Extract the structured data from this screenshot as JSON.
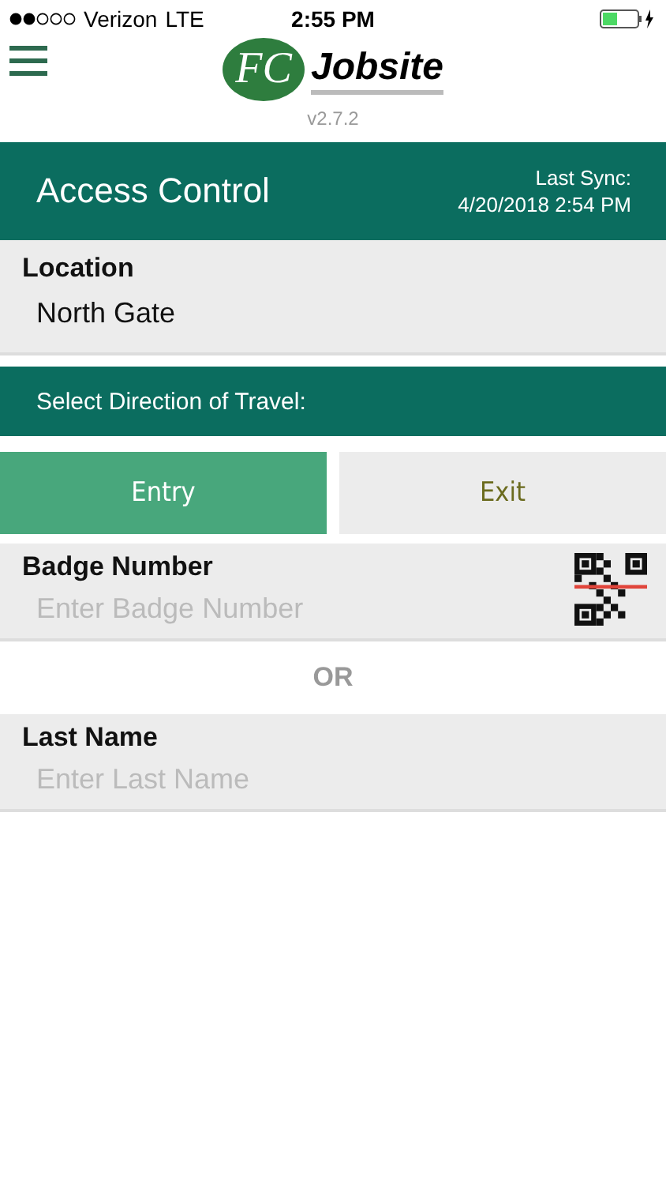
{
  "status_bar": {
    "carrier": "Verizon",
    "network": "LTE",
    "time": "2:55 PM"
  },
  "header": {
    "logo_mark": "FC",
    "logo_text": "Jobsite",
    "version": "v2.7.2"
  },
  "title_bar": {
    "title": "Access Control",
    "sync_label": "Last Sync:",
    "sync_time": "4/20/2018 2:54 PM"
  },
  "location": {
    "label": "Location",
    "value": "North Gate"
  },
  "direction": {
    "prompt": "Select Direction of Travel:",
    "options": [
      {
        "label": "Entry",
        "selected": true
      },
      {
        "label": "Exit",
        "selected": false
      }
    ]
  },
  "badge": {
    "label": "Badge Number",
    "placeholder": "Enter Badge Number"
  },
  "separator": "OR",
  "last_name": {
    "label": "Last Name",
    "placeholder": "Enter Last Name"
  }
}
